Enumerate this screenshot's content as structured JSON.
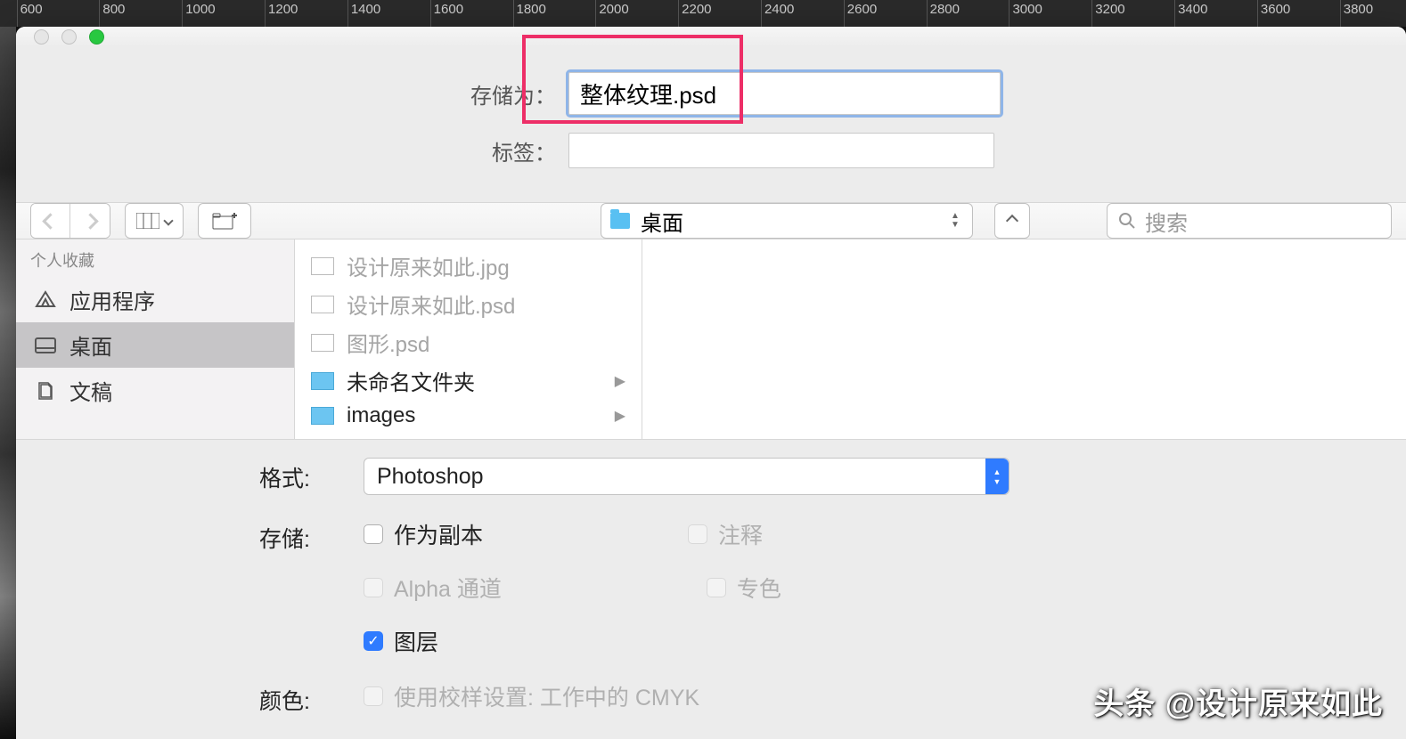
{
  "ruler": {
    "start": 600,
    "end": 3800,
    "step": 200
  },
  "dialog": {
    "saveAsLabel": "存储为：",
    "filename": "整体纹理.psd",
    "tagsLabel": "标签：",
    "tags": ""
  },
  "toolbar": {
    "location": "桌面",
    "searchPlaceholder": "搜索"
  },
  "sidebar": {
    "header": "个人收藏",
    "items": [
      {
        "label": "应用程序",
        "selected": false
      },
      {
        "label": "桌面",
        "selected": true
      },
      {
        "label": "文稿",
        "selected": false
      }
    ]
  },
  "files": [
    {
      "name": "设计原来如此.jpg",
      "enabled": false,
      "folder": false
    },
    {
      "name": "设计原来如此.psd",
      "enabled": false,
      "folder": false
    },
    {
      "name": "图形.psd",
      "enabled": false,
      "folder": false
    },
    {
      "name": "未命名文件夹",
      "enabled": true,
      "folder": true
    },
    {
      "name": "images",
      "enabled": true,
      "folder": true
    }
  ],
  "options": {
    "formatLabel": "格式:",
    "formatValue": "Photoshop",
    "storageLabel": "存储:",
    "asCopy": "作为副本",
    "notes": "注释",
    "alpha": "Alpha 通道",
    "spot": "专色",
    "layers": "图层",
    "colorLabel": "颜色:",
    "proof": "使用校样设置: 工作中的 CMYK"
  },
  "watermark": "头条 @设计原来如此"
}
